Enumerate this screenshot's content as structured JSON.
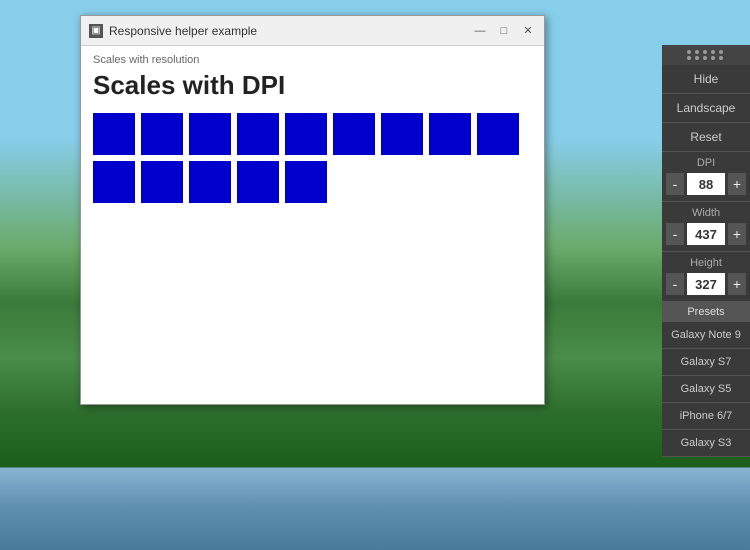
{
  "background": {
    "description": "Landscape with mountains, lake, and green hills"
  },
  "window": {
    "title": "Responsive helper example",
    "subtitle": "Scales with resolution",
    "heading": "Scales with DPI",
    "row1_blocks": 9,
    "row2_blocks": 5
  },
  "sidebar": {
    "hide_label": "Hide",
    "landscape_label": "Landscape",
    "reset_label": "Reset",
    "dpi_label": "DPI",
    "dpi_value": "88",
    "dpi_minus": "-",
    "dpi_plus": "+",
    "width_label": "Width",
    "width_value": "437",
    "width_minus": "-",
    "width_plus": "+",
    "height_label": "Height",
    "height_value": "327",
    "height_minus": "-",
    "height_plus": "+",
    "presets_label": "Presets",
    "presets": [
      "Galaxy Note 9",
      "Galaxy S7",
      "Galaxy S5",
      "iPhone 6/7",
      "Galaxy S3"
    ]
  }
}
